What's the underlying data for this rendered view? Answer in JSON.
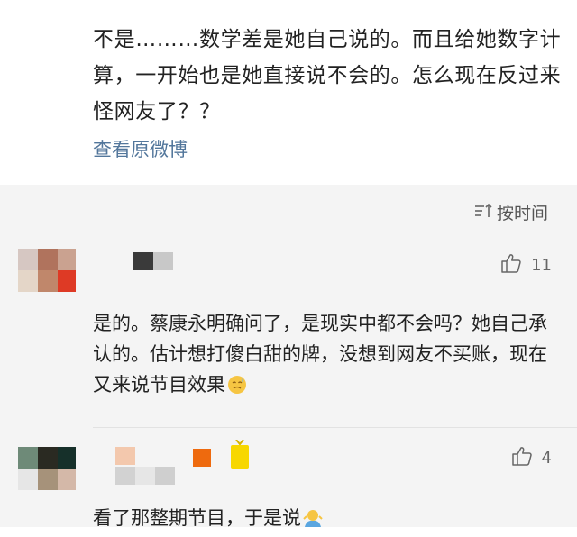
{
  "post": {
    "text": "不是………数学差是她自己说的。而且给她数字计算，一开始也是她直接说不会的。怎么现在反过来怪网友了？？",
    "view_original_label": "查看原微博"
  },
  "sort": {
    "label": "按时间",
    "icon": "sort-icon"
  },
  "comments": [
    {
      "likes": "11",
      "text": "是的。蔡康永明确问了，是现实中都不会吗？她自己承认的。估计想打傻白甜的牌，没想到网友不买账，现在又来说节目效果",
      "emoji": "sweat-face-emoji"
    },
    {
      "likes": "4",
      "text": "看了那整期节目，于是说",
      "emoji": "shrug-emoji"
    }
  ],
  "colors": {
    "link": "#52769b",
    "background": "#f4f4f4"
  }
}
